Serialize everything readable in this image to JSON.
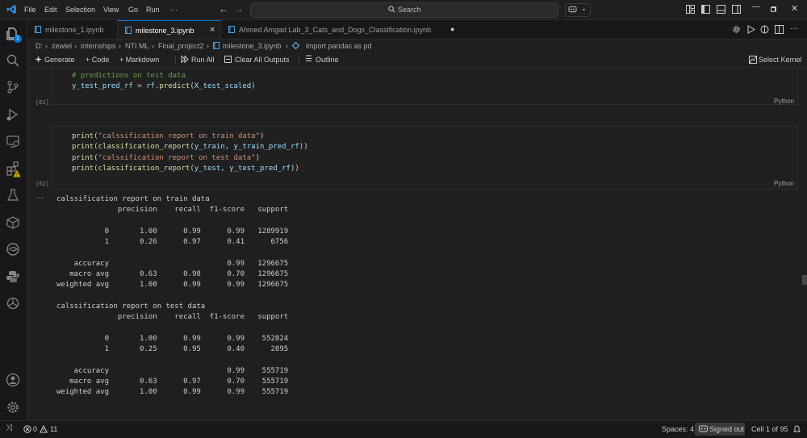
{
  "menu": [
    "File",
    "Edit",
    "Selection",
    "View",
    "Go",
    "Run",
    "···"
  ],
  "search": {
    "label": "Search"
  },
  "tabs": [
    {
      "label": "milestone_1.ipynb",
      "active": false
    },
    {
      "label": "milestone_3.ipynb",
      "active": true,
      "close": "×"
    },
    {
      "label": "Ahmed Amgad Lab_3_Cats_and_Dogs_Classification.ipynb",
      "active": false,
      "dirty": "●"
    }
  ],
  "breadcrumb": [
    "D:",
    "zewiel",
    "internships",
    "NTI ML",
    "Final_project2",
    "milestone_3.ipynb",
    "import pandas as pd"
  ],
  "toolbar": {
    "generate": "Generate",
    "code": "+ Code",
    "markdown": "+ Markdown",
    "run_all": "Run All",
    "clear_outputs": "Clear All Outputs",
    "outline": "Outline",
    "select_kernel": "Select Kernel"
  },
  "cells": {
    "cell1": {
      "exec_count": "[61]",
      "lines": [
        "# predictions on test data",
        "y_test_pred_rf = rf.predict(X_test_scaled)"
      ],
      "language": "Python"
    },
    "cell2": {
      "exec_count": "[62]",
      "lines": [
        "print(\"calssification report on train data\")",
        "print(classification_report(y_train, y_train_pred_rf))",
        "print(\"calssification report on test data\")",
        "print(classification_report(y_test, y_test_pred_rf))"
      ],
      "language": "Python"
    }
  },
  "output": {
    "ellipsis": "···",
    "train_title": "calssification report on train data",
    "test_title": "calssification report on test data",
    "header": "              precision    recall  f1-score   support",
    "train_rows": [
      "           0       1.00      0.99      0.99   1289919",
      "           1       0.26      0.97      0.41      6756",
      "    accuracy                           0.99   1296675",
      "   macro avg       0.63      0.98      0.70   1296675",
      "weighted avg       1.00      0.99      0.99   1296675"
    ],
    "test_rows": [
      "           0       1.00      0.99      0.99    552824",
      "           1       0.25      0.95      0.40      2895",
      "    accuracy                           0.99    555719",
      "   macro avg       0.63      0.97      0.70    555719",
      "weighted avg       1.00      0.99      0.99    555719"
    ]
  },
  "statusbar": {
    "errors": "0",
    "warnings": "11",
    "spaces": "Spaces: 4",
    "signed_out": "Signed out",
    "cell_position": "Cell 1 of 95"
  },
  "activity_badge": "1",
  "colors": {
    "accent": "#0078d4",
    "comment": "#6a9955",
    "function": "#dcdcaa",
    "variable": "#9cdcfe",
    "string": "#ce9178",
    "warning": "#cca700"
  }
}
